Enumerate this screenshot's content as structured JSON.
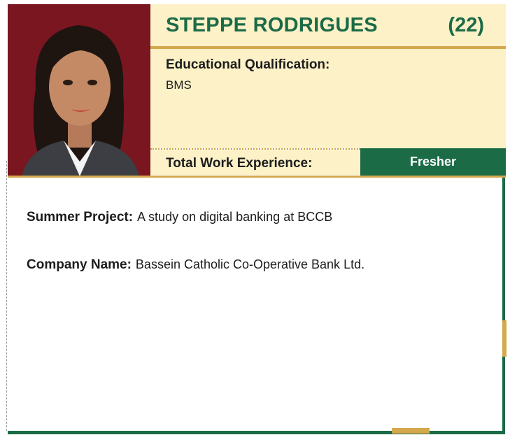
{
  "profile": {
    "name": "STEPPE RODRIGUES",
    "roll": "(22)",
    "photo_alt": "Portrait photo"
  },
  "qualification": {
    "label": "Educational Qualification:",
    "value": "BMS"
  },
  "experience": {
    "label": "Total Work Experience:",
    "value": "Fresher"
  },
  "details": {
    "summer_project_label": "Summer Project:",
    "summer_project_value": "A study on digital banking at BCCB",
    "company_label": "Company Name:",
    "company_value": "Bassein Catholic Co-Operative Bank Ltd."
  },
  "colors": {
    "brand_green": "#1a6b46",
    "accent_gold": "#d4a84c",
    "panel_cream": "#fdf1c8",
    "photo_backdrop": "#7a1620"
  }
}
